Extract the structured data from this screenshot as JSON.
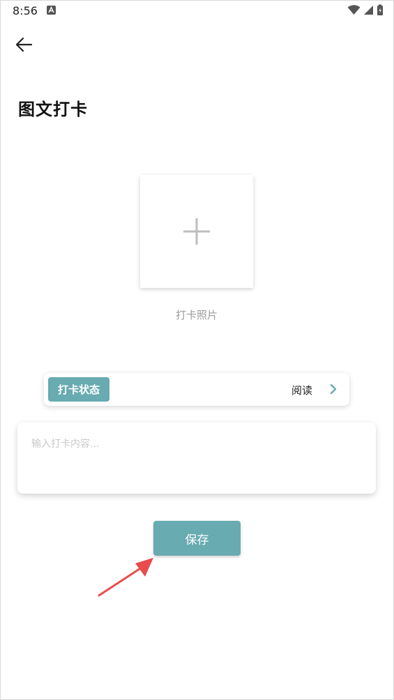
{
  "status_bar": {
    "time": "8:56"
  },
  "header": {
    "title": "图文打卡"
  },
  "photo": {
    "caption": "打卡照片"
  },
  "checkin_status": {
    "tag_label": "打卡状态",
    "value": "阅读"
  },
  "content": {
    "placeholder": "输入打卡内容..."
  },
  "actions": {
    "save_label": "保存"
  },
  "colors": {
    "accent": "#68abb1",
    "annotation_arrow": "#e84c4c"
  }
}
